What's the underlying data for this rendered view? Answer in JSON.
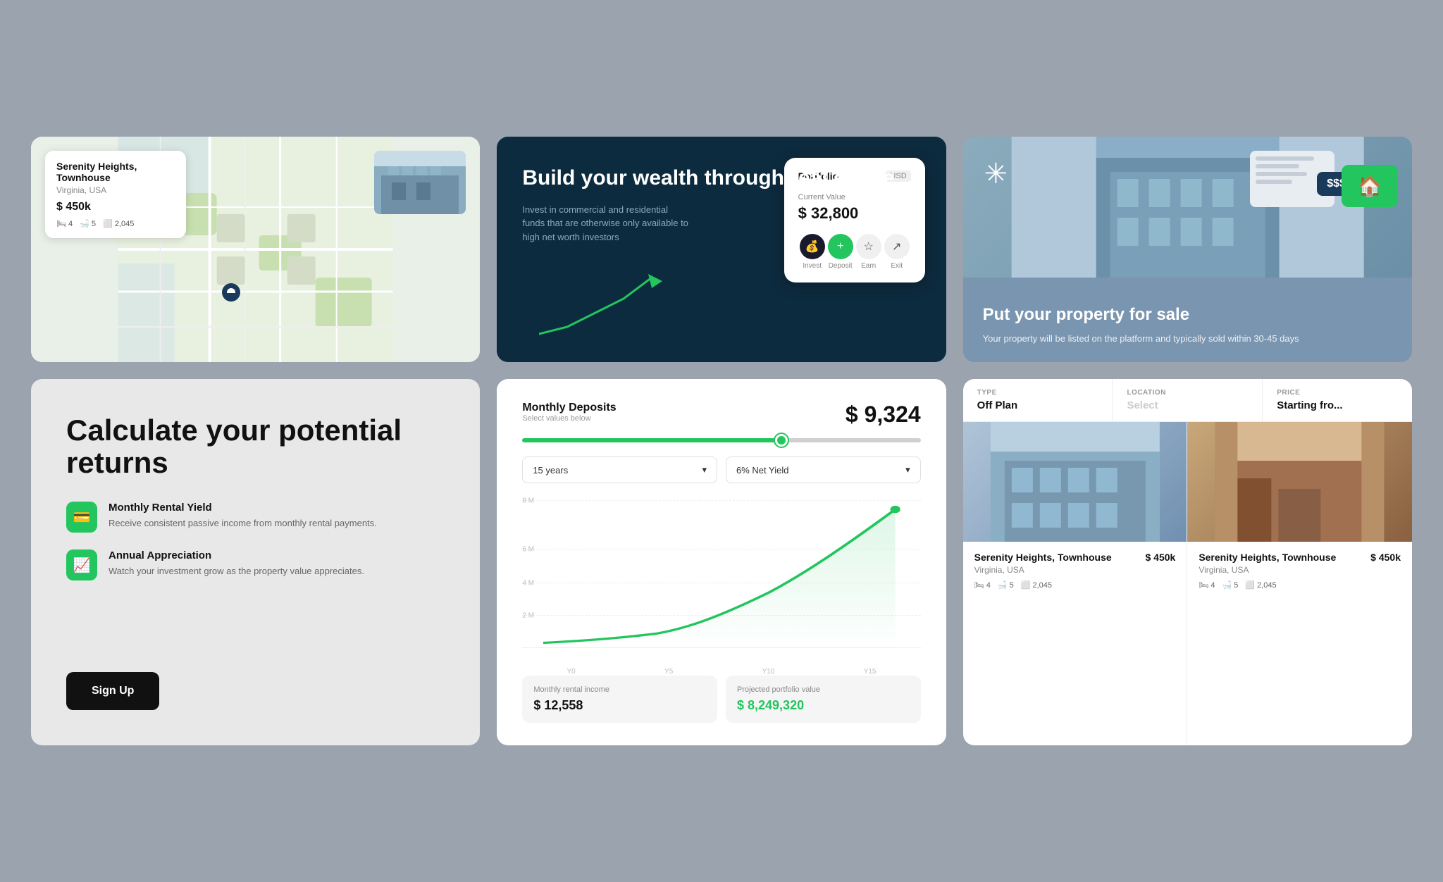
{
  "page": {
    "background": "#9ba3af"
  },
  "card_map": {
    "title": "Serenity Heights, Townhouse",
    "location": "Virginia, USA",
    "price": "$ 450k",
    "beds": "4",
    "baths": "5",
    "sqft": "2,045"
  },
  "card_wealth": {
    "heading": "Build your wealth through real estate",
    "description": "Invest in commercial and residential funds that are otherwise only available to high net worth investors",
    "portfolio_title": "Portfolio",
    "portfolio_currency": "USD",
    "portfolio_value_label": "Current Value",
    "portfolio_value": "$ 32,800",
    "actions": [
      {
        "label": "Invest",
        "icon": "💰"
      },
      {
        "label": "Deposit",
        "icon": "+"
      },
      {
        "label": "Earn",
        "icon": "⭐"
      },
      {
        "label": "Exit",
        "icon": "↗"
      }
    ]
  },
  "card_sale": {
    "heading": "Put your property for sale",
    "description": "Your property will be listed on the platform and typically sold within 30-45 days",
    "price_tag": "$$$"
  },
  "card_calculate": {
    "heading": "Calculate your potential returns",
    "features": [
      {
        "name": "feature-rental",
        "icon": "💳",
        "title": "Monthly Rental Yield",
        "description": "Receive consistent passive income from monthly rental payments."
      },
      {
        "name": "feature-appreciation",
        "icon": "📈",
        "title": "Annual Appreciation",
        "description": "Watch your investment grow as the property value appreciates."
      }
    ],
    "signup_button": "Sign Up"
  },
  "card_calculator": {
    "title": "Monthly Deposits",
    "subtitle": "Select values below",
    "amount": "$ 9,324",
    "slider_percent": 65,
    "dropdown_years": "15 years",
    "dropdown_yield": "6% Net Yield",
    "chart": {
      "y_labels": [
        "8 M",
        "6 M",
        "4 M",
        "2 M"
      ],
      "x_labels": [
        "Y0",
        "Y5",
        "Y10",
        "Y15"
      ]
    },
    "stat_monthly_label": "Monthly rental income",
    "stat_monthly_value": "$ 12,558",
    "stat_portfolio_label": "Projected portfolio value",
    "stat_portfolio_value": "$ 8,249,320"
  },
  "card_listings": {
    "filters": [
      {
        "label": "TYPE",
        "value": "Off Plan"
      },
      {
        "label": "LOCATION",
        "value": "Select",
        "placeholder": true
      },
      {
        "label": "PRICE",
        "value": "Starting fro..."
      }
    ],
    "properties": [
      {
        "name": "Serenity Heights, Townhouse",
        "location": "Virginia, USA",
        "price": "$ 450k",
        "beds": "4",
        "baths": "5",
        "sqft": "2,045",
        "img_style": "building"
      },
      {
        "name": "Serenity Heights, Townhouse",
        "location": "Virginia, USA",
        "price": "$ 450k",
        "beds": "4",
        "baths": "5",
        "sqft": "2,045",
        "img_style": "warm"
      }
    ]
  }
}
